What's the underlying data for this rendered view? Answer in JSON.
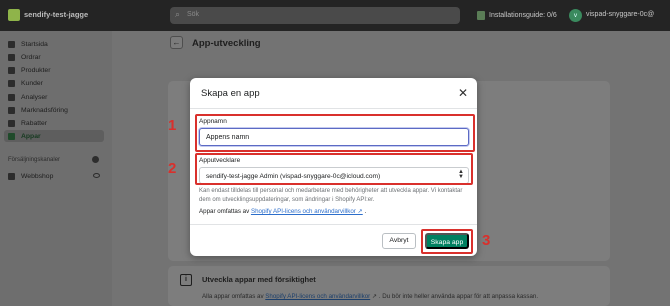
{
  "topbar": {
    "store_name": "sendify-test-jagge",
    "search_placeholder": "Sök",
    "setup_guide": "Installationsguide: 0/6",
    "avatar_initial": "v",
    "user_name": "vispad-snyggare-0c@"
  },
  "sidebar": {
    "items": [
      {
        "label": "Startsida",
        "icon": "home-icon"
      },
      {
        "label": "Ordrar",
        "icon": "orders-icon"
      },
      {
        "label": "Produkter",
        "icon": "tag-icon"
      },
      {
        "label": "Kunder",
        "icon": "person-icon"
      },
      {
        "label": "Analyser",
        "icon": "bar-chart-icon"
      },
      {
        "label": "Marknadsföring",
        "icon": "megaphone-icon"
      },
      {
        "label": "Rabatter",
        "icon": "discount-icon"
      },
      {
        "label": "Appar",
        "icon": "apps-icon",
        "active": true
      }
    ],
    "sales_channels_label": "Försäljningskanaler",
    "channels": [
      {
        "label": "Webbshop",
        "icon": "store-icon"
      }
    ]
  },
  "page": {
    "title": "App-utveckling"
  },
  "background_card": {
    "title": "Utveckla appar med försiktighet",
    "text_prefix": "Alla appar omfattas av ",
    "text_link": "Shopify API-licens och användarvillkor",
    "text_suffix": " ↗ . Du bör inte heller använda appar för att anpassa kassan."
  },
  "modal": {
    "title": "Skapa en app",
    "app_name_label": "Appnamn",
    "app_name_value": "Appens namn",
    "developer_label": "Apputvecklare",
    "developer_value": "sendify-test-jagge Admin (vispad-snyggare-0c@icloud.com)",
    "help_text": "Kan endast tilldelas till personal och medarbetare med behörigheter att utveckla appar. Vi kontaktar dem om utvecklingsuppdateringar, som ändringar i Shopify API:er.",
    "terms_prefix": "Appar omfattas av ",
    "terms_link": "Shopify API-licens och användarvillkor ↗",
    "terms_suffix": " .",
    "cancel_label": "Avbryt",
    "create_label": "Skapa app"
  },
  "annotations": {
    "step1": "1",
    "step2": "2",
    "step3": "3",
    "color": "#d9302c"
  },
  "colors": {
    "primary": "#008060",
    "focus": "#5c6ac4",
    "link": "#2c6ecb"
  }
}
